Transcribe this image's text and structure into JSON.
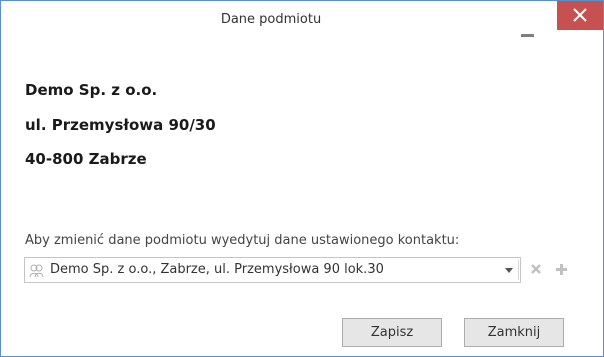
{
  "window": {
    "title": "Dane podmiotu"
  },
  "entity": {
    "name": "Demo Sp. z o.o.",
    "street": "ul. Przemysłowa 90/30",
    "city": "40-800 Zabrze"
  },
  "contact": {
    "hint": "Aby zmienić dane podmiotu wyedytuj dane ustawionego kontaktu:",
    "selected": "Demo Sp. z o.o., Zabrze, ul. Przemysłowa 90 lok.30",
    "icon": "contact-icon"
  },
  "buttons": {
    "save": "Zapisz",
    "close": "Zamknij"
  },
  "colors": {
    "close_button": "#c75050",
    "window_border": "#5a8fc9"
  }
}
